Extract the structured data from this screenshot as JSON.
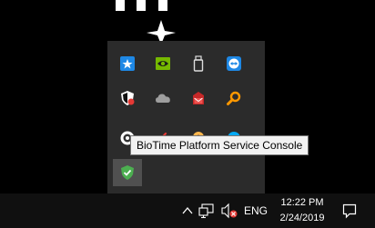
{
  "tooltip": {
    "text": "BioTime Platform Service Console"
  },
  "taskbar": {
    "language": "ENG",
    "time": "12:22 PM",
    "date": "2/24/2019"
  },
  "tray_icons": [
    "star-app-icon",
    "nvidia-icon",
    "usb-drive-icon",
    "teamviewer-icon",
    "security-shield-icon",
    "onedrive-cloud-icon",
    "mail-icon",
    "search-tool-icon",
    "biotime-icon",
    "chrome-icon",
    "app-icon",
    "skype-icon",
    "shield-check-icon"
  ],
  "colors": {
    "flyout": "#2b2b2b",
    "taskbar": "#101010",
    "tooltip_bg": "#f2f2f2",
    "accent_blue": "#1e88e5",
    "nvidia_green": "#76b900"
  }
}
